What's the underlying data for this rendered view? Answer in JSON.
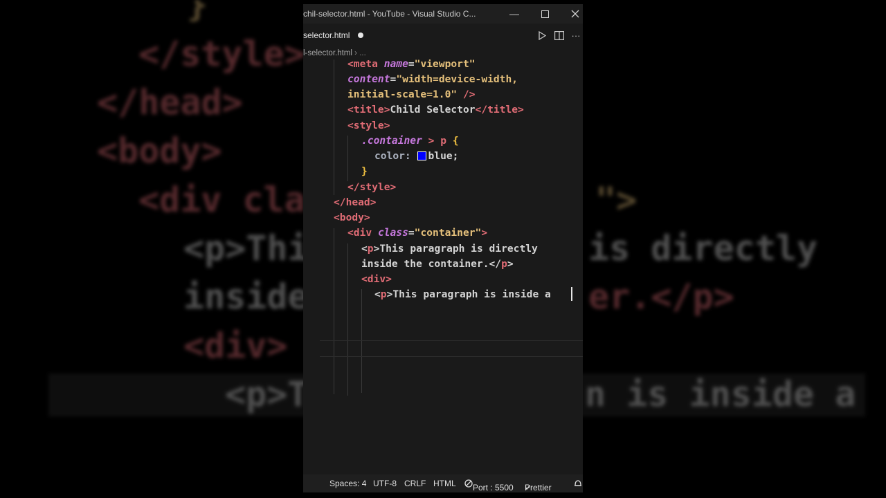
{
  "window": {
    "title": "chil-selector.html - YouTube - Visual Studio C...",
    "tab_label": "selector.html",
    "breadcrumb_file": "l-selector.html",
    "breadcrumb_rest": "..."
  },
  "background_lines": [
    {
      "text": "}"
    },
    {
      "text": "</style>"
    },
    {
      "text": "</head>"
    },
    {
      "text": "<body>"
    },
    {
      "text": "<div cla",
      "tail": "\">"
    },
    {
      "text": "<p>Thi",
      "tail": "is directly"
    },
    {
      "text": "inside",
      "tail": "er.</p>"
    },
    {
      "text": "<div>"
    },
    {
      "text": "<p>T",
      "tail": "n is inside a"
    }
  ],
  "code": {
    "l1_tag": "<meta ",
    "l1_attr": "name",
    "l1_eq": "=",
    "l1_val": "\"viewport\"",
    "l2_attr": "content",
    "l2_eq": "=",
    "l2_val": "\"width=device-width,",
    "l3_val": "initial-scale=1.0\"",
    "l3_end": " />",
    "l4_open": "<title>",
    "l4_text": "Child Selector",
    "l4_close": "</title>",
    "l5": "<style>",
    "l6_sel": ".container",
    "l6_op": " > ",
    "l6_p": "p",
    "l6_brace": " {",
    "l7_prop": "color: ",
    "l7_val": "blue;",
    "l8": "}",
    "l9": "</style>",
    "l10": "</head>",
    "l11": "<body>",
    "l12_tag": "<div ",
    "l12_attr": "class",
    "l12_eq": "=",
    "l12_val": "\"container\"",
    "l12_end": ">",
    "l13_open": "<",
    "l13_p": "p",
    "l13_gt": ">",
    "l13_text": "This paragraph is directly",
    "l14_text": "inside the container.",
    "l14_close": "</",
    "l14_p": "p",
    "l14_gt": ">",
    "l15": "<div>",
    "l16_open": "<",
    "l16_p": "p",
    "l16_gt": ">",
    "l16_text": "This paragraph is inside a"
  },
  "status": {
    "spaces": "Spaces: 4",
    "encoding": "UTF-8",
    "eol": "CRLF",
    "language": "HTML",
    "port": "Port : 5500",
    "prettier": "Prettier"
  },
  "colors": {
    "swatch": "#0000ff",
    "tag": "#e06c75",
    "string": "#e5c07b",
    "attr": "#c678dd"
  }
}
